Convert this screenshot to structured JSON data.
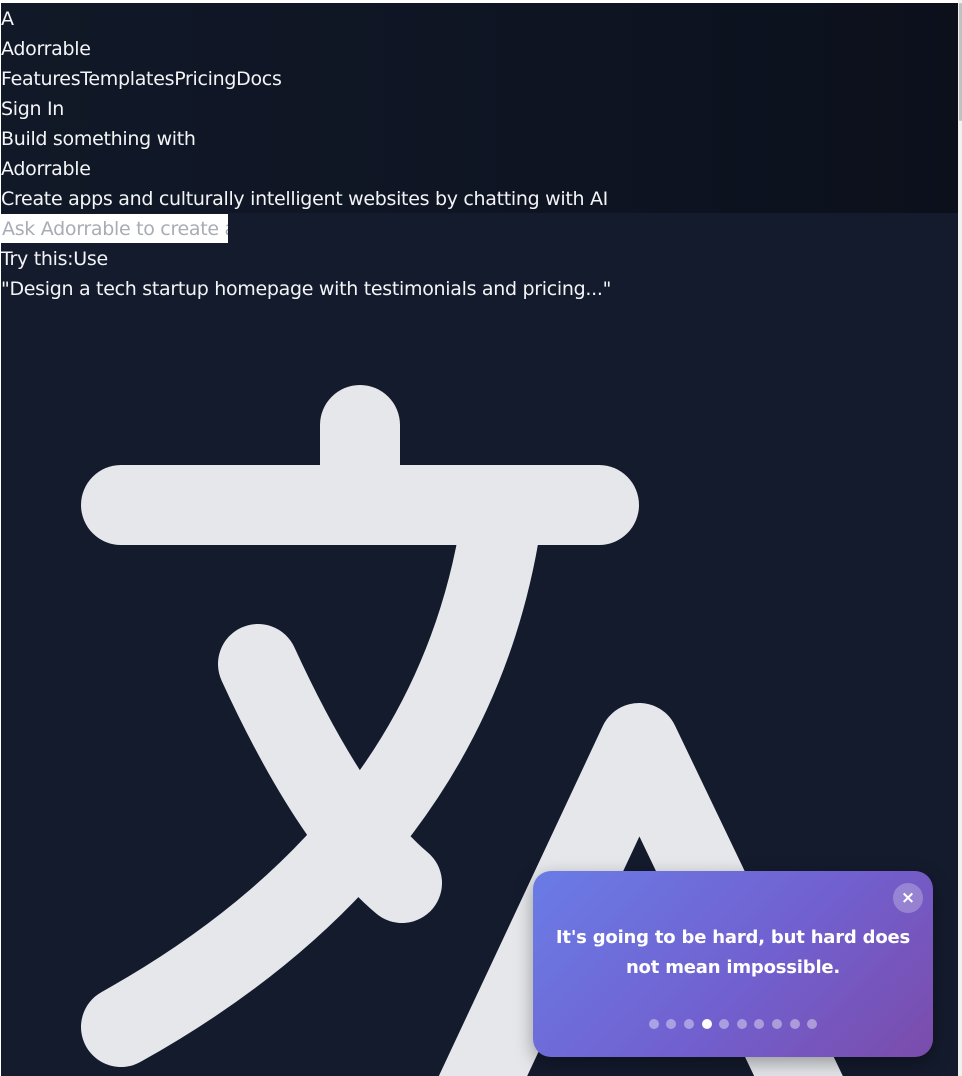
{
  "header": {
    "logo_letter": "A",
    "brand": "Adorrable",
    "nav": [
      "Features",
      "Templates",
      "Pricing",
      "Docs"
    ],
    "sign_in": "Sign In"
  },
  "hero": {
    "title_line1": "Build something with",
    "title_line2": "Adorrable",
    "subtitle": "Create apps and culturally intelligent websites by chatting with AI"
  },
  "prompt": {
    "placeholder": "Ask Adorrable to create a",
    "try_label": "Try this:",
    "use_label": "Use",
    "suggestion": "\"Design a tech startup homepage with testimonials and pricing...\""
  },
  "background_icon": "translate-icon",
  "toast": {
    "close_label": "×",
    "quote": "It's going to be hard, but hard does not mean impossible.",
    "dot_count": 10,
    "active_index": 3,
    "gradient_start": "#6a7ce6",
    "gradient_end": "#7b4cab"
  },
  "colors": {
    "background": "#141b2d",
    "header_band": "#0d1320",
    "text": "#f3f4f6",
    "icon": "#e5e7eb"
  }
}
